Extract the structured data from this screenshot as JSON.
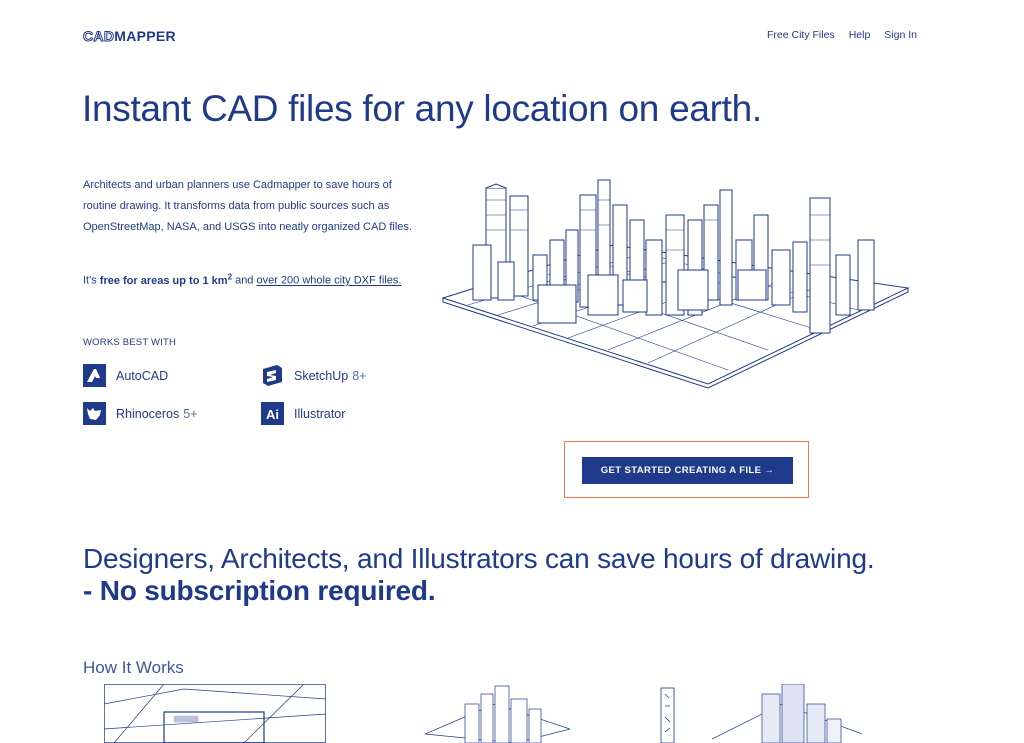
{
  "brand": {
    "logo_cad": "CAD",
    "logo_mapper": "MAPPER"
  },
  "nav": {
    "items": [
      {
        "label": "Free City Files"
      },
      {
        "label": "Help"
      },
      {
        "label": "Sign In"
      }
    ]
  },
  "hero": {
    "title": "Instant CAD files for any location on earth."
  },
  "intro": {
    "paragraph": "Architects and urban planners use Cadmapper to save hours of routine drawing. It transforms data from public sources such as OpenStreetMap, NASA, and USGS into neatly organized CAD files.",
    "free_prefix": "It's ",
    "free_bold": "free for areas up to 1 km",
    "free_sup": "2",
    "free_mid": " and ",
    "free_link": "over 200 whole city DXF files."
  },
  "works_with": {
    "label": "WORKS BEST WITH",
    "apps": [
      {
        "name": "AutoCAD",
        "version": "",
        "icon": "autocad-icon"
      },
      {
        "name": "SketchUp",
        "version": "8+",
        "icon": "sketchup-icon"
      },
      {
        "name": "Rhinoceros",
        "version": "5+",
        "icon": "rhino-icon"
      },
      {
        "name": "Illustrator",
        "version": "",
        "icon": "illustrator-icon"
      }
    ]
  },
  "cta": {
    "label": "GET STARTED CREATING A FILE →"
  },
  "tagline": {
    "line1": "Designers, Architects, and Illustrators can save hours of drawing.",
    "line2": "- No subscription required."
  },
  "how": {
    "title": "How It Works"
  },
  "colors": {
    "primary": "#1f3a8a",
    "highlight_border": "#f07a4a",
    "background": "#ffffff"
  }
}
